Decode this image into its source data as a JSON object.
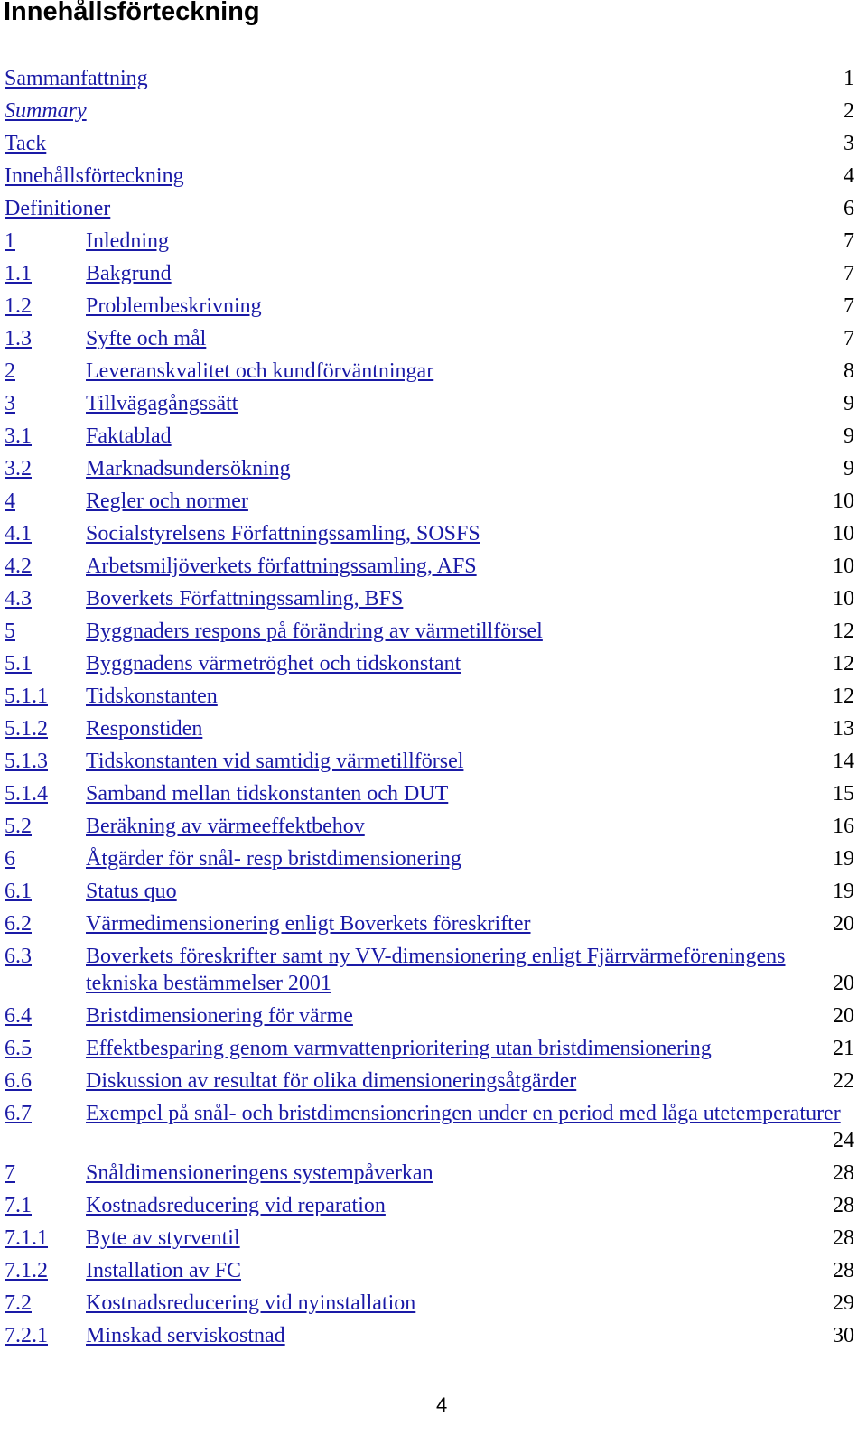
{
  "title": "Innehållsförteckning",
  "entries": [
    {
      "num": "",
      "label": "Sammanfattning",
      "page": "1"
    },
    {
      "num": "",
      "label": "Summary",
      "page": "2",
      "italic": true
    },
    {
      "num": "",
      "label": "Tack",
      "page": "3"
    },
    {
      "num": "",
      "label": "Innehållsförteckning",
      "page": "4"
    },
    {
      "num": "",
      "label": "Definitioner",
      "page": "6"
    },
    {
      "num": "1",
      "label": "Inledning",
      "page": "7"
    },
    {
      "num": "1.1",
      "label": "Bakgrund",
      "page": "7"
    },
    {
      "num": "1.2",
      "label": "Problembeskrivning",
      "page": "7"
    },
    {
      "num": "1.3",
      "label": "Syfte och mål",
      "page": "7"
    },
    {
      "num": "2",
      "label": "Leveranskvalitet och kundförväntningar",
      "page": "8"
    },
    {
      "num": "3",
      "label": "Tillvägagångssätt",
      "page": "9"
    },
    {
      "num": "3.1",
      "label": "Faktablad",
      "page": "9"
    },
    {
      "num": "3.2",
      "label": "Marknadsundersökning",
      "page": "9"
    },
    {
      "num": "4",
      "label": "Regler och normer",
      "page": "10"
    },
    {
      "num": "4.1",
      "label": "Socialstyrelsens Författningssamling, SOSFS",
      "page": "10"
    },
    {
      "num": "4.2",
      "label": "Arbetsmiljöverkets författningssamling, AFS",
      "page": "10"
    },
    {
      "num": "4.3",
      "label": "Boverkets Författningssamling, BFS",
      "page": "10"
    },
    {
      "num": "5",
      "label": "Byggnaders respons på förändring av värmetillförsel",
      "page": "12"
    },
    {
      "num": "5.1",
      "label": "Byggnadens värmetröghet och tidskonstant",
      "page": "12"
    },
    {
      "num": "5.1.1",
      "label": "Tidskonstanten",
      "page": "12"
    },
    {
      "num": "5.1.2",
      "label": "Responstiden",
      "page": "13"
    },
    {
      "num": "5.1.3",
      "label": "Tidskonstanten vid samtidig värmetillförsel",
      "page": "14"
    },
    {
      "num": "5.1.4",
      "label": "Samband mellan tidskonstanten och DUT",
      "page": "15"
    },
    {
      "num": "5.2",
      "label": "Beräkning av värmeeffektbehov",
      "page": "16"
    },
    {
      "num": "6",
      "label": "Åtgärder för snål- resp bristdimensionering",
      "page": "19"
    },
    {
      "num": "6.1",
      "label": "Status quo",
      "page": "19"
    },
    {
      "num": "6.2",
      "label": "Värmedimensionering enligt Boverkets föreskrifter",
      "page": "20"
    },
    {
      "num": "6.3",
      "label": "Boverkets föreskrifter samt ny VV-dimensionering enligt Fjärrvärmeföreningens tekniska bestämmelser 2001",
      "page": "20",
      "two_line": true
    },
    {
      "num": "6.4",
      "label": "Bristdimensionering för värme",
      "page": "20"
    },
    {
      "num": "6.5",
      "label": "Effektbesparing genom varmvattenprioritering utan bristdimensionering",
      "page": "21"
    },
    {
      "num": "6.6",
      "label": "Diskussion av resultat för olika dimensioneringsåtgärder",
      "page": "22"
    },
    {
      "num": "6.7",
      "label": "Exempel på snål- och bristdimensioneringen under en period med låga utetemperaturer",
      "page": "24",
      "two_line": true
    },
    {
      "num": "7",
      "label": "Snåldimensioneringens systempåverkan",
      "page": "28"
    },
    {
      "num": "7.1",
      "label": "Kostnadsreducering vid reparation",
      "page": "28"
    },
    {
      "num": "7.1.1",
      "label": "Byte av styrventil",
      "page": "28"
    },
    {
      "num": "7.1.2",
      "label": "Installation av FC",
      "page": "28"
    },
    {
      "num": "7.2",
      "label": "Kostnadsreducering vid nyinstallation",
      "page": "29"
    },
    {
      "num": "7.2.1",
      "label": "Minskad serviskostnad",
      "page": "30"
    }
  ],
  "footer": {
    "page_number": "4"
  },
  "colors": {
    "link": "#1a1aa6",
    "text": "#000000"
  }
}
